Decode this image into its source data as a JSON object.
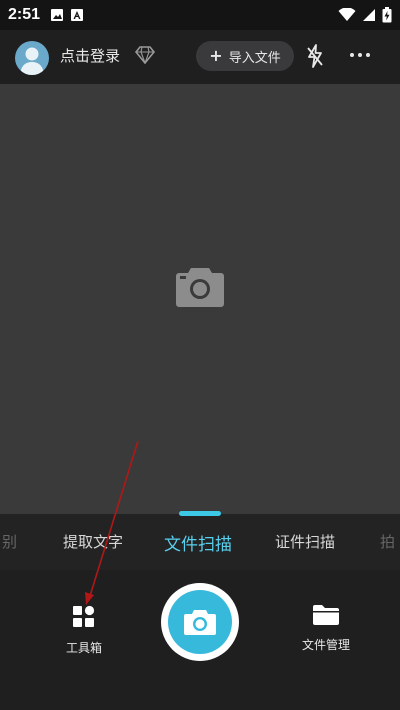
{
  "status": {
    "time": "2:51"
  },
  "header": {
    "login_label": "点击登录",
    "import_label": "导入文件",
    "import_plus": "+"
  },
  "tabs": [
    {
      "label": "别",
      "state": "faded"
    },
    {
      "label": "提取文字",
      "state": "normal"
    },
    {
      "label": "文件扫描",
      "state": "active"
    },
    {
      "label": "证件扫描",
      "state": "normal"
    },
    {
      "label": "拍",
      "state": "faded"
    }
  ],
  "bottom": {
    "toolbox_label": "工具箱",
    "files_label": "文件管理"
  },
  "colors": {
    "accent": "#3ec8e8",
    "shutter": "#37b9dc",
    "viewfinder": "#3a3a3a",
    "annotation_arrow": "#b01818"
  }
}
